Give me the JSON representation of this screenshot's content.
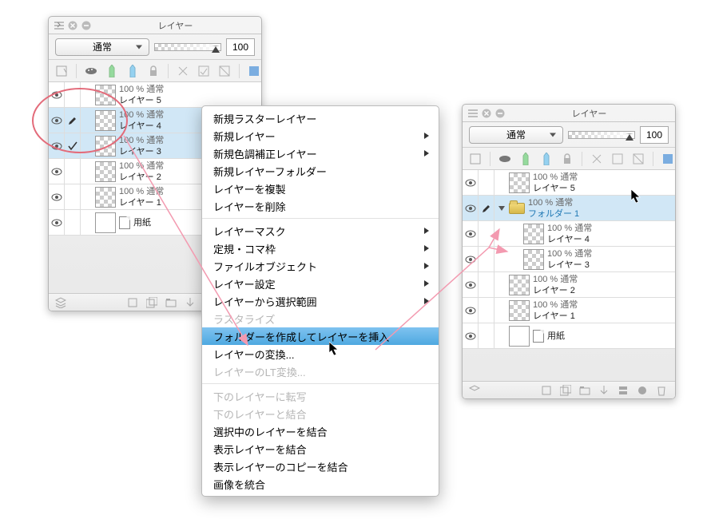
{
  "panel_title": "レイヤー",
  "blend_mode": "通常",
  "opacity_value": "100",
  "layer_text_prefix": "100 % 通常",
  "left_panel": {
    "layers": [
      {
        "name": "レイヤー 5",
        "selected": false,
        "status": ""
      },
      {
        "name": "レイヤー 4",
        "selected": true,
        "status": "brush"
      },
      {
        "name": "レイヤー 3",
        "selected": true,
        "status": "check"
      },
      {
        "name": "レイヤー 2",
        "selected": false,
        "status": ""
      },
      {
        "name": "レイヤー 1",
        "selected": false,
        "status": ""
      }
    ],
    "paper_label": "用紙"
  },
  "right_panel": {
    "layer5": "レイヤー 5",
    "folder": "フォルダー 1",
    "layer4": "レイヤー 4",
    "layer3": "レイヤー 3",
    "layer2": "レイヤー 2",
    "layer1": "レイヤー 1",
    "paper_label": "用紙"
  },
  "menu": {
    "new_raster": "新規ラスターレイヤー",
    "new_layer": "新規レイヤー",
    "new_correction": "新規色調補正レイヤー",
    "new_folder": "新規レイヤーフォルダー",
    "duplicate": "レイヤーを複製",
    "delete": "レイヤーを削除",
    "mask": "レイヤーマスク",
    "ruler": "定規・コマ枠",
    "file_obj": "ファイルオブジェクト",
    "settings": "レイヤー設定",
    "selection": "レイヤーから選択範囲",
    "rasterize": "ラスタライズ",
    "insert_folder": "フォルダーを作成してレイヤーを挿入",
    "convert": "レイヤーの変換...",
    "lt_convert": "レイヤーのLT変換...",
    "transfer_down": "下のレイヤーに転写",
    "merge_down": "下のレイヤーと結合",
    "merge_selected": "選択中のレイヤーを結合",
    "merge_visible": "表示レイヤーを結合",
    "copy_merge_visible": "表示レイヤーのコピーを結合",
    "flatten": "画像を統合"
  }
}
